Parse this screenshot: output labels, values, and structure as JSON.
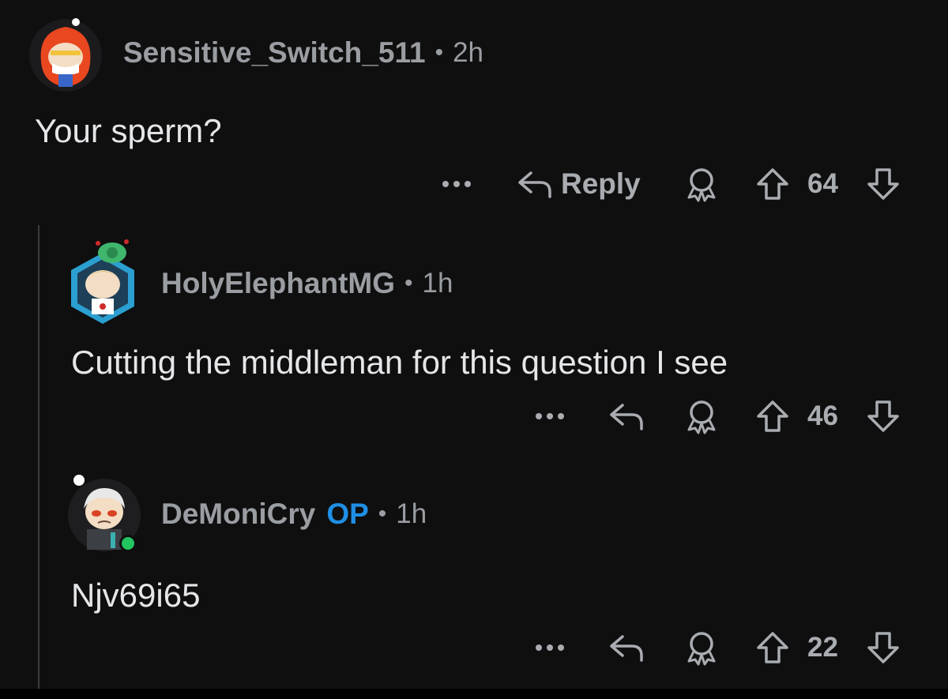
{
  "comments": [
    {
      "username": "Sensitive_Switch_511",
      "separator": "•",
      "age": "2h",
      "body": "Your sperm?",
      "reply_label": "Reply",
      "votes": "64",
      "op": ""
    },
    {
      "username": "HolyElephantMG",
      "separator": "•",
      "age": "1h",
      "body": "Cutting the middleman for this question I see",
      "reply_label": "",
      "votes": "46",
      "op": ""
    },
    {
      "username": "DeMoniCry",
      "separator": "•",
      "age": "1h",
      "body": "Njv69i65",
      "reply_label": "",
      "votes": "22",
      "op": "OP"
    }
  ],
  "colors": {
    "background": "#0f0f10",
    "text": "#e4e6e8",
    "muted": "#9a9da1",
    "op_badge": "#1f8fe5",
    "online": "#22c55e"
  },
  "icons": [
    "more-icon",
    "reply-icon",
    "award-icon",
    "upvote-icon",
    "downvote-icon"
  ]
}
